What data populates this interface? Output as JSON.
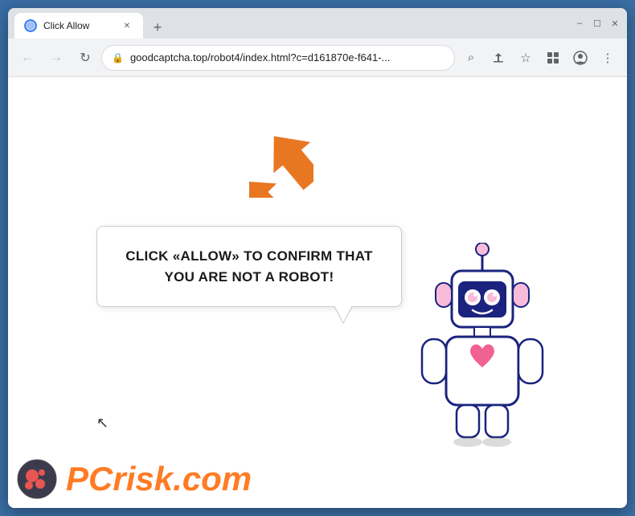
{
  "browser": {
    "tab": {
      "title": "Click Allow",
      "favicon_color": "#4285f4"
    },
    "new_tab_label": "+",
    "window_controls": {
      "minimize": "–",
      "maximize": "☐",
      "close": "✕"
    },
    "toolbar": {
      "back_icon": "←",
      "forward_icon": "→",
      "refresh_icon": "↻",
      "url": "goodcaptcha.top/robot4/index.html?c=d161870e-f641-...",
      "lock_icon": "🔒",
      "search_icon": "⌕",
      "share_icon": "↑",
      "bookmark_icon": "☆",
      "extension_icon": "▣",
      "profile_icon": "○",
      "menu_icon": "⋮"
    }
  },
  "page": {
    "bubble_text": "CLICK «ALLOW» TO CONFIRM THAT YOU ARE NOT A ROBOT!",
    "arrow_color": "#e87722"
  },
  "watermark": {
    "brand": "PC",
    "suffix": "risk.com"
  }
}
